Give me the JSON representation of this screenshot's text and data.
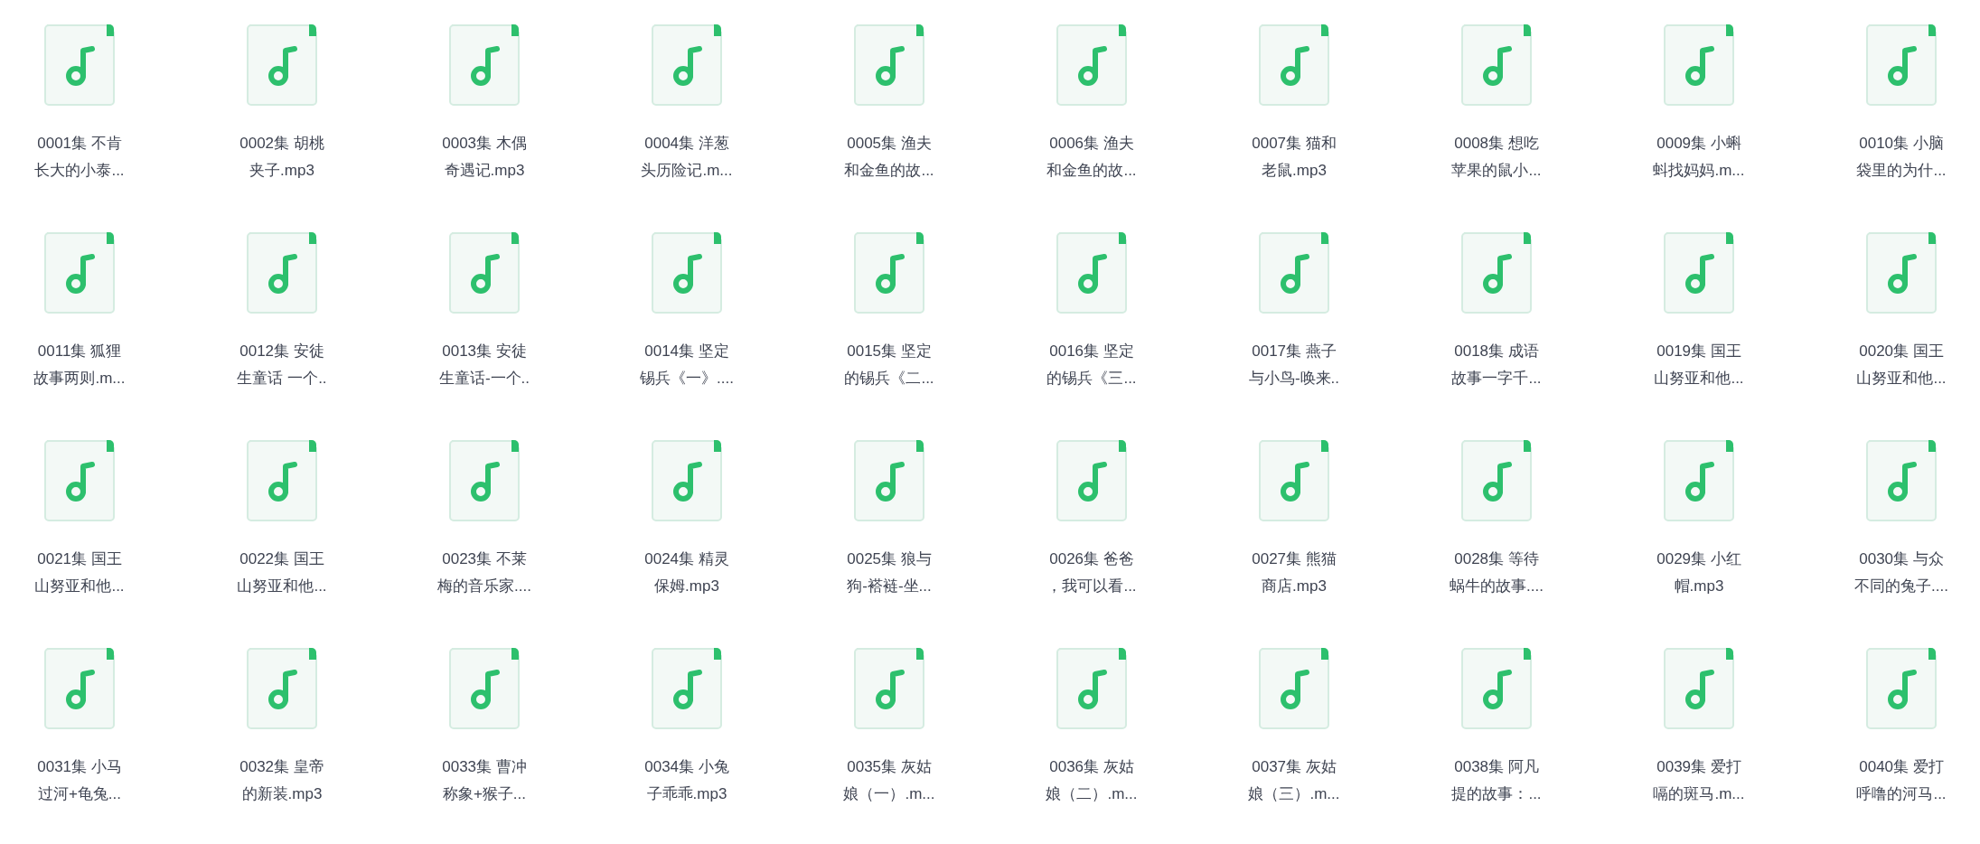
{
  "files": [
    {
      "lines": [
        "0001集 不肯",
        "长大的小泰..."
      ]
    },
    {
      "lines": [
        "0002集 胡桃",
        "夹子.mp3"
      ]
    },
    {
      "lines": [
        "0003集 木偶",
        "奇遇记.mp3"
      ]
    },
    {
      "lines": [
        "0004集 洋葱",
        "头历险记.m..."
      ]
    },
    {
      "lines": [
        "0005集 渔夫",
        "和金鱼的故..."
      ]
    },
    {
      "lines": [
        "0006集 渔夫",
        "和金鱼的故..."
      ]
    },
    {
      "lines": [
        "0007集 猫和",
        "老鼠.mp3"
      ]
    },
    {
      "lines": [
        "0008集 想吃",
        "苹果的鼠小..."
      ]
    },
    {
      "lines": [
        "0009集 小蝌",
        "蚪找妈妈.m..."
      ]
    },
    {
      "lines": [
        "0010集 小脑",
        "袋里的为什..."
      ]
    },
    {
      "lines": [
        "0011集 狐狸",
        "故事两则.m..."
      ]
    },
    {
      "lines": [
        "0012集 安徒",
        "生童话 一个.."
      ]
    },
    {
      "lines": [
        "0013集 安徒",
        "生童话-一个.."
      ]
    },
    {
      "lines": [
        "0014集 坚定",
        "锡兵《一》...."
      ]
    },
    {
      "lines": [
        "0015集 坚定",
        "的锡兵《二..."
      ]
    },
    {
      "lines": [
        "0016集 坚定",
        "的锡兵《三..."
      ]
    },
    {
      "lines": [
        "0017集 燕子",
        "与小鸟-唤来.."
      ]
    },
    {
      "lines": [
        "0018集 成语",
        "故事一字千..."
      ]
    },
    {
      "lines": [
        "0019集 国王",
        "山努亚和他..."
      ]
    },
    {
      "lines": [
        "0020集 国王",
        "山努亚和他..."
      ]
    },
    {
      "lines": [
        "0021集 国王",
        "山努亚和他..."
      ]
    },
    {
      "lines": [
        "0022集 国王",
        "山努亚和他..."
      ]
    },
    {
      "lines": [
        "0023集 不莱",
        "梅的音乐家...."
      ]
    },
    {
      "lines": [
        "0024集 精灵",
        "保姆.mp3"
      ]
    },
    {
      "lines": [
        "0025集 狼与",
        "狗-褡裢-坐..."
      ]
    },
    {
      "lines": [
        "0026集 爸爸",
        "，我可以看..."
      ]
    },
    {
      "lines": [
        "0027集 熊猫",
        "商店.mp3"
      ]
    },
    {
      "lines": [
        "0028集 等待",
        "蜗牛的故事...."
      ]
    },
    {
      "lines": [
        "0029集 小红",
        "帽.mp3"
      ]
    },
    {
      "lines": [
        "0030集 与众",
        "不同的兔子...."
      ]
    },
    {
      "lines": [
        "0031集 小马",
        "过河+龟兔..."
      ]
    },
    {
      "lines": [
        "0032集 皇帝",
        "的新装.mp3"
      ]
    },
    {
      "lines": [
        "0033集 曹冲",
        "称象+猴子..."
      ]
    },
    {
      "lines": [
        "0034集 小兔",
        "子乖乖.mp3"
      ]
    },
    {
      "lines": [
        "0035集 灰姑",
        "娘（一）.m..."
      ]
    },
    {
      "lines": [
        "0036集 灰姑",
        "娘（二）.m..."
      ]
    },
    {
      "lines": [
        "0037集 灰姑",
        "娘（三）.m..."
      ]
    },
    {
      "lines": [
        "0038集 阿凡",
        "提的故事：..."
      ]
    },
    {
      "lines": [
        "0039集 爱打",
        "嗝的斑马.m..."
      ]
    },
    {
      "lines": [
        "0040集 爱打",
        "呼噜的河马..."
      ]
    }
  ]
}
